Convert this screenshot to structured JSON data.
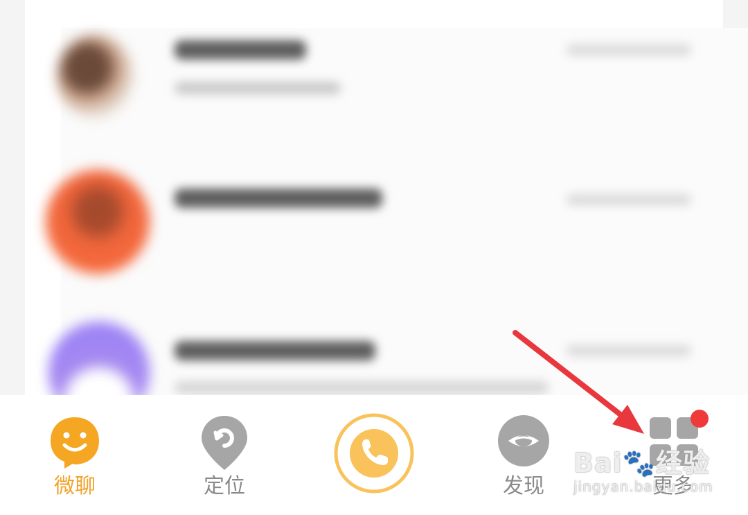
{
  "tabbar": {
    "tabs": [
      {
        "label": "微聊",
        "icon": "smile-chat-icon",
        "active": true
      },
      {
        "label": "定位",
        "icon": "location-pin-icon",
        "active": false
      },
      {
        "label": "",
        "icon": "phone-icon",
        "active": false
      },
      {
        "label": "发现",
        "icon": "discover-eye-icon",
        "active": false
      },
      {
        "label": "更多",
        "icon": "grid-more-icon",
        "active": false
      }
    ],
    "badge_on": "more"
  },
  "colors": {
    "accent": "#f5a623",
    "active_label": "#f2a22a",
    "inactive_icon": "#a6a6a6",
    "badge": "#f03a3a",
    "arrow": "#e8383d"
  },
  "watermark": {
    "brand": "Bai",
    "brand_cn": "经验",
    "sub": "jingyan.baidu.com"
  }
}
